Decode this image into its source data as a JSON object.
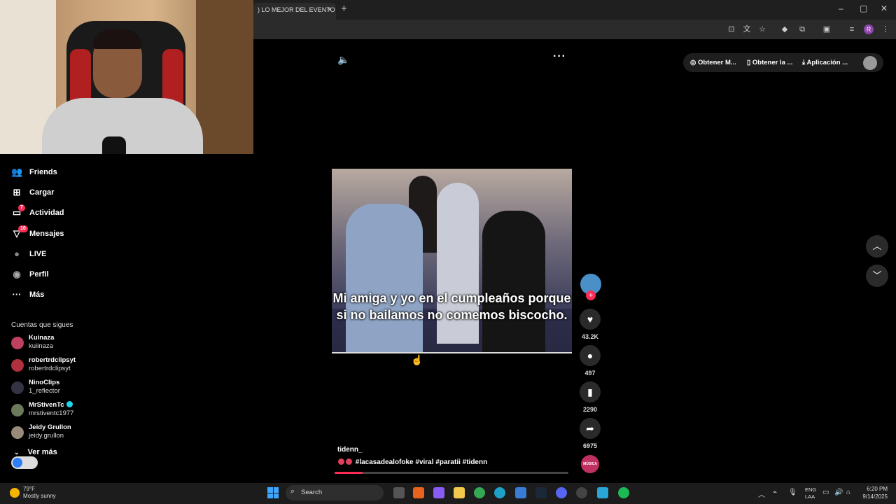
{
  "browser": {
    "tab_title": ") LO MEJOR DEL EVENTO C",
    "tab_close": "×",
    "new_tab": "+",
    "minimize": "–",
    "maximize": "▢",
    "close": "✕",
    "profile_initial": "R"
  },
  "sidebar": {
    "items": [
      {
        "label": "Friends",
        "icon": "friends-icon",
        "glyph": "👥"
      },
      {
        "label": "Cargar",
        "icon": "upload-icon",
        "glyph": "⊞"
      },
      {
        "label": "Actividad",
        "icon": "activity-icon",
        "glyph": "▭",
        "badge": "7"
      },
      {
        "label": "Mensajes",
        "icon": "messages-icon",
        "glyph": "▽",
        "badge": "10"
      },
      {
        "label": "LIVE",
        "icon": "live-icon",
        "glyph": "●"
      },
      {
        "label": "Perfil",
        "icon": "profile-icon",
        "glyph": "◉"
      },
      {
        "label": "Más",
        "icon": "more-icon",
        "glyph": "···"
      }
    ],
    "following_title": "Cuentas que sigues",
    "accounts": [
      {
        "name": "Kuinaza",
        "handle": "kuiinaza"
      },
      {
        "name": "robertrdclipsyt",
        "handle": "robertrdclipsyt"
      },
      {
        "name": "NinoClips",
        "handle": "1_reflector"
      },
      {
        "name": "MrStivenTc",
        "handle": "mrstiventc1977",
        "verified": true
      },
      {
        "name": "Jeidy Grullon",
        "handle": "jeidy.grullon"
      }
    ],
    "see_more": "Ver más"
  },
  "top_actions": {
    "pill1": "Obtener M...",
    "pill2": "Obtener la ...",
    "pill3": "Aplicación ..."
  },
  "video": {
    "caption": "Mi amiga y yo en el cumpleaños porque si no bailamos no comemos biscocho.",
    "author": "tidenn_",
    "hashtags": "#lacasadealofoke #viral #paratii #tidenn",
    "progress": 0.12
  },
  "actions": {
    "likes": "43.2K",
    "comments": "497",
    "saves": "2290",
    "shares": "6975",
    "music_label": "MÚSICA"
  },
  "taskbar": {
    "temp": "79°F",
    "weather": "Mostly sunny",
    "search": "Search",
    "lang1": "ENG",
    "lang2": "LAA",
    "time": "6:20 PM",
    "date": "9/14/2025"
  }
}
